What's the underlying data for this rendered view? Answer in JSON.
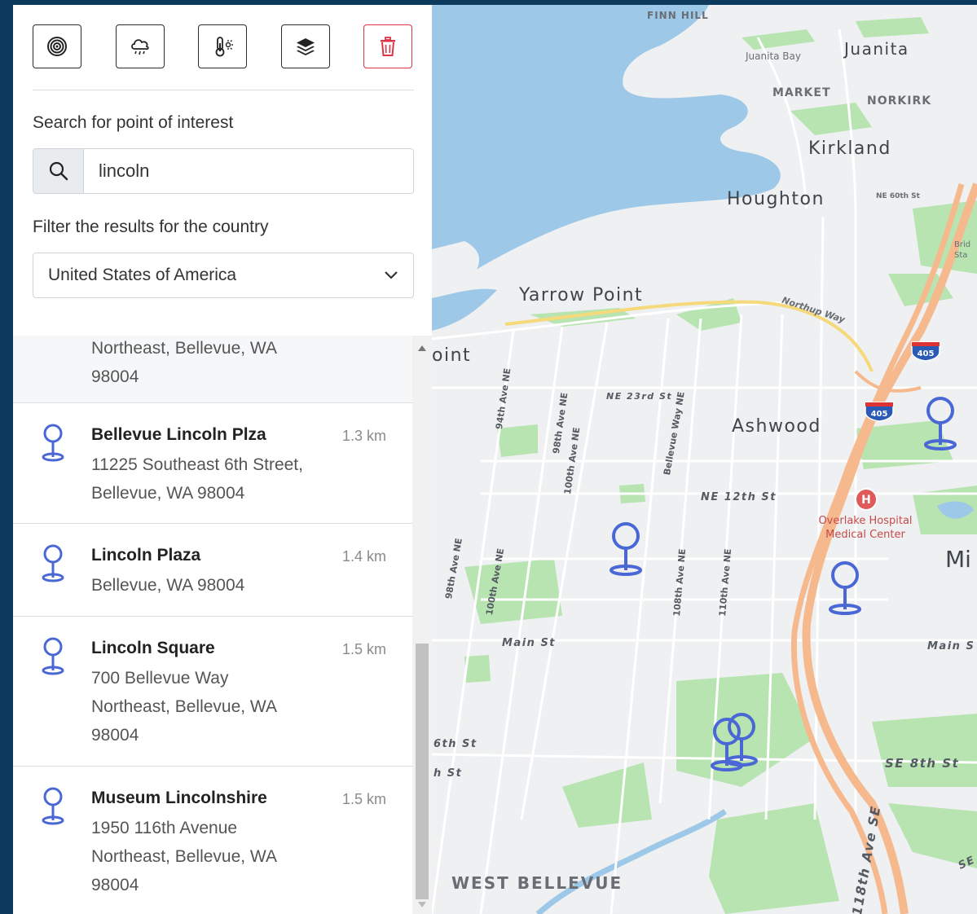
{
  "toolbar": {
    "buttons": [
      {
        "icon": "bullseye-icon"
      },
      {
        "icon": "rain-cloud-icon"
      },
      {
        "icon": "thermometer-sun-icon"
      },
      {
        "icon": "layers-icon"
      },
      {
        "icon": "trash-icon",
        "color": "#dc3545"
      }
    ]
  },
  "search": {
    "label": "Search for point of interest",
    "value": "lincoln",
    "placeholder": ""
  },
  "country_filter": {
    "label": "Filter the results for the country",
    "selected": "United States of America"
  },
  "results": [
    {
      "name": "",
      "address_lines": [
        "Northeast, Bellevue, WA",
        "98004"
      ],
      "distance": ""
    },
    {
      "name": "Bellevue Lincoln Plza",
      "address_lines": [
        "11225 Southeast 6th Street,",
        "Bellevue, WA 98004"
      ],
      "distance": "1.3 km"
    },
    {
      "name": "Lincoln Plaza",
      "address_lines": [
        "Bellevue, WA 98004"
      ],
      "distance": "1.4 km"
    },
    {
      "name": "Lincoln Square",
      "address_lines": [
        "700 Bellevue Way",
        "Northeast, Bellevue, WA",
        "98004"
      ],
      "distance": "1.5 km"
    },
    {
      "name": "Museum Lincolnshire",
      "address_lines": [
        "1950 116th Avenue",
        "Northeast, Bellevue, WA",
        "98004"
      ],
      "distance": "1.5 km"
    }
  ],
  "map": {
    "colors": {
      "water": "#9dc8e8",
      "park": "#b7e4b0",
      "land": "#eef0f2",
      "road": "#ffffff",
      "highway": "#f6b98e",
      "pin": "#4a67d6"
    },
    "labels": {
      "finn_hill": "FINN HILL",
      "juanita_bay": "Juanita Bay",
      "juanita": "Juanita",
      "market": "MARKET",
      "norkirk": "NORKIRK",
      "kirkland": "Kirkland",
      "houghton": "Houghton",
      "yarrow_point": "Yarrow Point",
      "point_fragment": "oint",
      "northup_way": "Northup Way",
      "ashwood": "Ashwood",
      "ne_23rd": "NE 23rd St",
      "ne_12th": "NE 12th St",
      "hospital": "Overlake Hospital Medical Center",
      "mi_fragment": "Mi",
      "main_st": "Main St",
      "main_st_right": "Main S",
      "sixth_st": "6th St",
      "h_st": "h St",
      "se_8th": "SE 8th St",
      "west_bellevue": "WEST BELLEVUE",
      "se_118th": "118th Ave SE",
      "se_fragment": "SE",
      "bridle_fragment": "Brid",
      "bridle_fragment_2": "Sta",
      "ave_94": "94th Ave NE",
      "ave_98": "98th Ave NE",
      "ave_100": "100th Ave NE",
      "bellevue_way": "Bellevue Way NE",
      "ave_98b": "98th Ave NE",
      "ave_100b": "100th Ave NE",
      "ave_108": "108th Ave NE",
      "ave_110": "110th Ave NE",
      "ne_60th": "NE 60th St",
      "interstate_1": "405",
      "interstate_2": "405",
      "hospital_badge": "H"
    },
    "pins": [
      {
        "label": "pin-1"
      },
      {
        "label": "pin-2"
      },
      {
        "label": "pin-3"
      },
      {
        "label": "pin-4"
      },
      {
        "label": "pin-5"
      }
    ]
  }
}
